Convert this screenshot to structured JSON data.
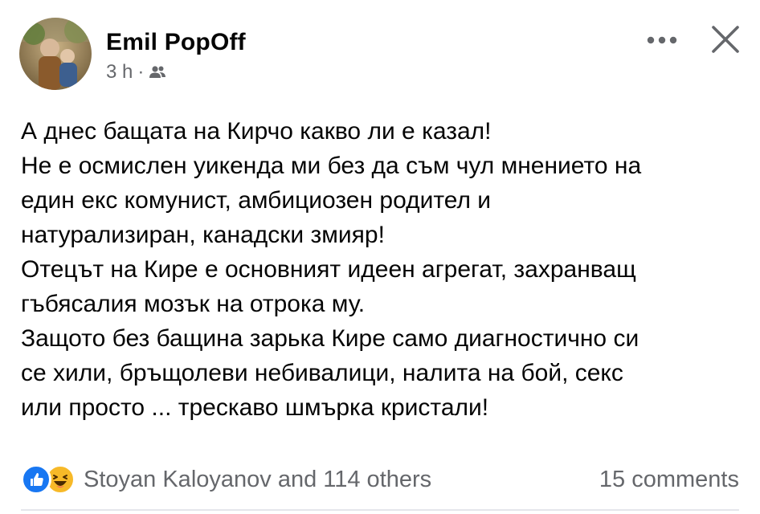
{
  "post": {
    "author": "Emil PopOff",
    "time": "3 h",
    "separator": "·",
    "audience_icon": "friends-icon",
    "more_icon": "ellipsis-icon",
    "close_icon": "close-icon",
    "text_lines": [
      "А днес бащата на Кирчо какво ли е казал!",
      "Не е осмислен уикенда ми без да съм чул мнението на",
      "един екс комунист, амбициозен родител и",
      "натурализиран, канадски змияр!",
      "Отецът на Кире е основният идеен агрегат, захранващ",
      "гъбясалия мозък на отрока му.",
      "Защото без бащина зарька Кире само диагностично си",
      "се хили, бръщолеви небивалици, налита на бой, секс",
      "или просто ... трескаво шмърка кристали!"
    ]
  },
  "footer": {
    "reaction_icons": [
      "like-icon",
      "haha-icon"
    ],
    "reactions_text": "Stoyan Kaloyanov and 114 others",
    "comments_text": "15 comments"
  },
  "colors": {
    "like_blue": "#1877f2",
    "haha_yellow": "#f7b928",
    "secondary_text": "#65676b"
  }
}
